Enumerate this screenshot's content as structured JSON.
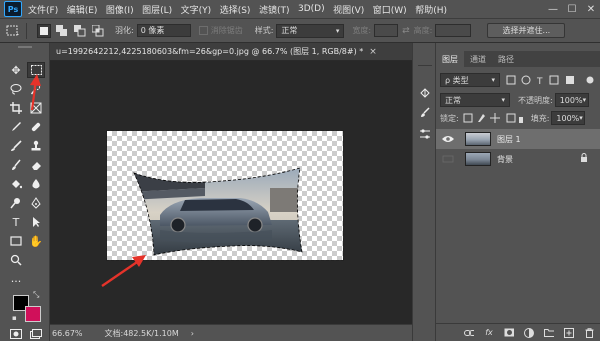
{
  "menu": {
    "logo": "Ps",
    "items": [
      "文件(F)",
      "编辑(E)",
      "图像(I)",
      "图层(L)",
      "文字(Y)",
      "选择(S)",
      "滤镜(T)",
      "3D(D)",
      "视图(V)",
      "窗口(W)",
      "帮助(H)"
    ],
    "minimize": "—",
    "maximize": "☐",
    "close": "✕"
  },
  "options": {
    "feather_label": "羽化:",
    "feather_value": "0 像素",
    "antialias_label": "消除锯齿",
    "style_label": "样式:",
    "style_value": "正常",
    "width_label": "宽度:",
    "height_label": "高度:",
    "select_mask_button": "选择并遮住..."
  },
  "document": {
    "tab_title": "u=1992642212,4225180603&fm=26&gp=0.jpg @ 66.7% (图层 1, RGB/8#) *",
    "tab_close": "×",
    "zoom": "66.67%",
    "doc_size": "文档:482.5K/1.10M",
    "status_arrow": "›"
  },
  "colors": {
    "foreground": "#000000",
    "background": "#d0105a",
    "accent_arrow": "#e5332a"
  },
  "layers_panel": {
    "tabs": [
      "图层",
      "通道",
      "路径"
    ],
    "filter_kind": "ρ 类型",
    "blend_mode": "正常",
    "opacity_label": "不透明度:",
    "opacity_value": "100%",
    "lock_label": "锁定:",
    "fill_label": "填充:",
    "fill_value": "100%",
    "layers": [
      {
        "name": "图层 1",
        "visible": true,
        "selected": true
      },
      {
        "name": "背景",
        "visible": false,
        "selected": false,
        "locked": true
      }
    ]
  }
}
